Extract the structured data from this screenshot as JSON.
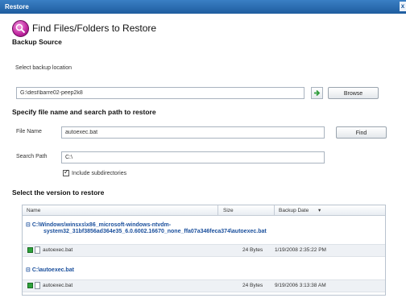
{
  "window": {
    "title": "Restore",
    "close_glyph": "x"
  },
  "header": {
    "title": "Find Files/Folders to Restore",
    "icon": "magnifier-icon"
  },
  "backup_source": {
    "section": "Backup Source",
    "location_label": "Select backup location",
    "location_value": "G:\\dest\\barre02-peep2k8",
    "browse_label": "Browse"
  },
  "search": {
    "section": "Specify file name and search path to restore",
    "file_name_label": "File Name",
    "file_name_value": "autoexec.bat",
    "find_label": "Find",
    "search_path_label": "Search Path",
    "search_path_value": "C:\\",
    "include_subdirs_label": "Include subdirectories",
    "include_subdirs_checked": true
  },
  "versions": {
    "section": "Select the version to restore",
    "columns": [
      "Name",
      "Size",
      "Backup Date"
    ],
    "groups": [
      {
        "path_line1": "C:\\Windows\\winsxs\\x86_microsoft-windows-ntvdm-",
        "path_line2": "system32_31bf3856ad364e35_6.0.6002.16670_none_ffa07a346feca374\\autoexec.bat",
        "rows": [
          {
            "name": "autoexec.bat",
            "size": "24 Bytes",
            "date": "1/19/2008 2:35:22 PM"
          }
        ]
      },
      {
        "path_line1": "C:\\autoexec.bat",
        "rows": [
          {
            "name": "autoexec.bat",
            "size": "24 Bytes",
            "date": "9/19/2006 3:13:38 AM"
          }
        ]
      }
    ]
  },
  "colors": {
    "titlebar": "#1f5d9f",
    "link": "#1a4f9c",
    "accent_icon": "#c0259f",
    "row_marker": "#2ea33a"
  }
}
